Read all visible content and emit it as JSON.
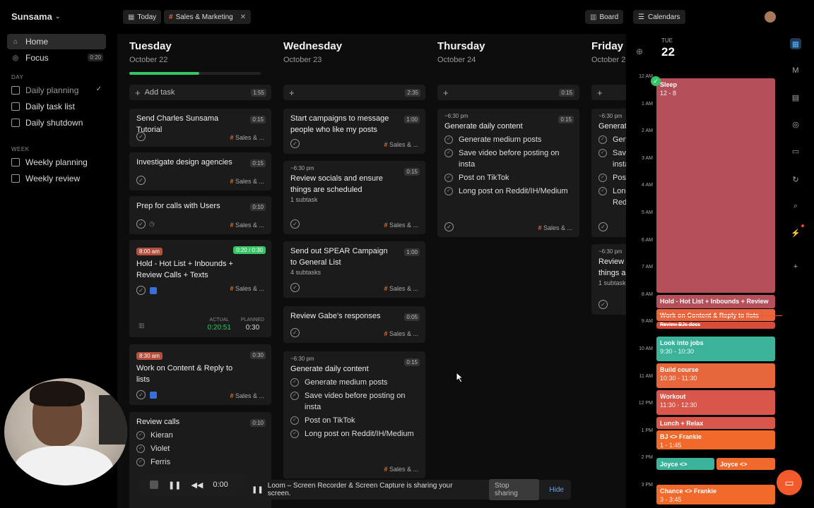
{
  "sidebar": {
    "brand": "Sunsama",
    "home": "Home",
    "focus": "Focus",
    "focus_time": "0:20",
    "day_section": "DAY",
    "daily_planning": "Daily planning",
    "daily_task_list": "Daily task list",
    "daily_shutdown": "Daily shutdown",
    "week_section": "WEEK",
    "weekly_planning": "Weekly planning",
    "weekly_review": "Weekly review"
  },
  "toolbar": {
    "today": "Today",
    "channel_filter": "Sales & Marketing",
    "board": "Board",
    "calendars": "Calendars"
  },
  "days": [
    {
      "name": "Tuesday",
      "date": "October 22",
      "add_label": "Add task",
      "total": "1:55",
      "progress": 0.53
    },
    {
      "name": "Wednesday",
      "date": "October 23",
      "total": "2:35"
    },
    {
      "name": "Thursday",
      "date": "October 24",
      "total": "0:15"
    },
    {
      "name": "Friday",
      "date": "October 2"
    }
  ],
  "tag": "Sales & ...",
  "tuesday": {
    "t1": {
      "title": "Send Charles Sunsama Tutorial",
      "dur": "0:15"
    },
    "t2": {
      "title": "Investigate design agencies",
      "dur": "0:15"
    },
    "t3": {
      "title": "Prep for calls with Users",
      "dur": "0:10"
    },
    "t4": {
      "time": "8:00 am",
      "title": "Hold - Hot List + Inbounds + Review Calls + Texts",
      "ratio": "0:20 / 0:30",
      "actual_label": "ACTUAL",
      "actual": "0:20:51",
      "planned_label": "PLANNED",
      "planned": "0:30"
    },
    "t5": {
      "time": "8:30 am",
      "title": "Work on Content & Reply to lists",
      "dur": "0:30"
    },
    "t6": {
      "title": "Review calls",
      "dur": "0:10",
      "subtasks": [
        "Kieran",
        "Violet",
        "Ferris"
      ]
    }
  },
  "wednesday": {
    "w1": {
      "title": "Start campaigns to message people who like my posts",
      "dur": "1:00"
    },
    "w2": {
      "pre": "~6:30 pm",
      "title": "Review socials and ensure things are scheduled",
      "sub": "1 subtask",
      "dur": "0:15"
    },
    "w3": {
      "title": "Send out SPEAR Campaign to General List",
      "sub": "4 subtasks",
      "dur": "1:00"
    },
    "w4": {
      "title": "Review Gabe's responses",
      "dur": "0:05"
    },
    "w5": {
      "pre": "~6:30 pm",
      "title": "Generate daily content",
      "dur": "0:15",
      "subtasks": [
        "Generate medium posts",
        "Save video before posting on insta",
        "Post on TikTok",
        "Long post on Reddit/IH/Medium"
      ]
    }
  },
  "thursday": {
    "th1": {
      "pre": "~6:30 pm",
      "title": "Generate daily content",
      "dur": "0:15",
      "subtasks": [
        "Generate medium posts",
        "Save video before posting on insta",
        "Post on TikTok",
        "Long post on Reddit/IH/Medium"
      ]
    }
  },
  "friday": {
    "f1": {
      "pre": "~6:30 pm",
      "title": "Generate",
      "subtasks": [
        "Gene",
        "Save",
        "insta",
        "Post",
        "Long",
        "Redd"
      ]
    },
    "f2": {
      "pre": "~6:30 pm",
      "title": "Review so",
      "title2": "things are",
      "sub": "1 subtask"
    }
  },
  "calendar": {
    "dow": "TUE",
    "dom": "22",
    "hours": [
      "12 AM",
      "1 AM",
      "2 AM",
      "3 AM",
      "4 AM",
      "5 AM",
      "6 AM",
      "7 AM",
      "8 AM",
      "9 AM",
      "10 AM",
      "11 AM",
      "12 PM",
      "1 PM",
      "2 PM",
      "3 PM"
    ],
    "events": {
      "sleep": {
        "title": "Sleep",
        "time": "12 - 8"
      },
      "hold": {
        "title": "Hold - Hot List + Inbounds + Review"
      },
      "work": {
        "title": "Work on Content & Reply to lists"
      },
      "review": {
        "title": "Review BJs docs"
      },
      "jobs": {
        "title": "Look into jobs",
        "time": "9:30 - 10:30"
      },
      "course": {
        "title": "Build course",
        "time": "10:30 - 11:30"
      },
      "workout": {
        "title": "Workout",
        "time": "11:30 - 12:30"
      },
      "lunch": {
        "title": "Lunch + Relax"
      },
      "bj": {
        "title": "BJ <> Frankie",
        "time": "1 - 1:45"
      },
      "joyce1": {
        "title": "Joyce <> Frankie"
      },
      "joyce2": {
        "title": "Joyce <> Frankie"
      },
      "chance": {
        "title": "Chance <> Frankie",
        "time": "3 - 3:45"
      }
    }
  },
  "loom": {
    "timer": "0:00",
    "message": "Loom – Screen Recorder & Screen Capture is sharing your screen.",
    "stop": "Stop sharing",
    "hide": "Hide"
  },
  "colors": {
    "accent_green": "#35c466",
    "tag_orange": "#e0703a",
    "sleep": "#b5505a",
    "teal": "#3bb39a",
    "orange": "#e8663c"
  }
}
